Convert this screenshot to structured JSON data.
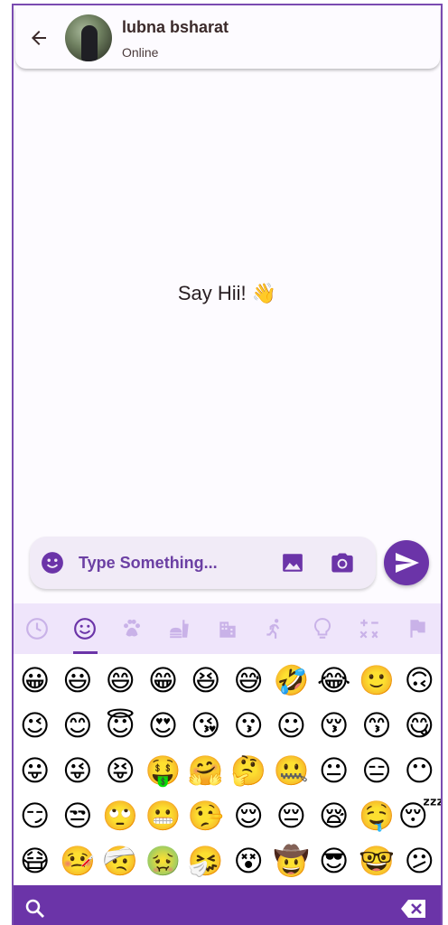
{
  "header": {
    "contact_name": "lubna bsharat",
    "status": "Online",
    "icons": {
      "back": "arrow-back-icon",
      "avatar": "profile-photo"
    }
  },
  "chat": {
    "empty_text": "Say Hii!",
    "empty_emoji": "👋"
  },
  "composer": {
    "placeholder": "Type Something...",
    "icons": [
      "emoji-icon",
      "image-icon",
      "camera-icon",
      "send-icon"
    ]
  },
  "emoji_picker": {
    "active_category": "smileys",
    "categories": [
      "recent",
      "smileys",
      "animals",
      "food",
      "travel",
      "activities",
      "objects",
      "symbols",
      "flags"
    ],
    "emojis": [
      "😀",
      "😃",
      "😄",
      "😁",
      "😆",
      "😅",
      "🤣",
      "😂",
      "🙂",
      "🙃",
      "😉",
      "😊",
      "😇",
      "😍",
      "😘",
      "😗",
      "☺",
      "😚",
      "😙",
      "😋",
      "😛",
      "😜",
      "😝",
      "🤑",
      "🤗",
      "🤔",
      "🤐",
      "😐",
      "😑",
      "😶",
      "😏",
      "😒",
      "🙄",
      "😬",
      "🤥",
      "😌",
      "😔",
      "😪",
      "🤤",
      "😴",
      "😷",
      "🤒",
      "🤕",
      "🤢",
      "🤧",
      "😵",
      "🤠",
      "😎",
      "🤓",
      "😕"
    ],
    "bottom_icons": [
      "search-icon",
      "backspace-icon"
    ]
  },
  "colors": {
    "accent": "#6b34a8",
    "category_bar": "#efe5fb",
    "input_bg": "#f1ebf7"
  }
}
